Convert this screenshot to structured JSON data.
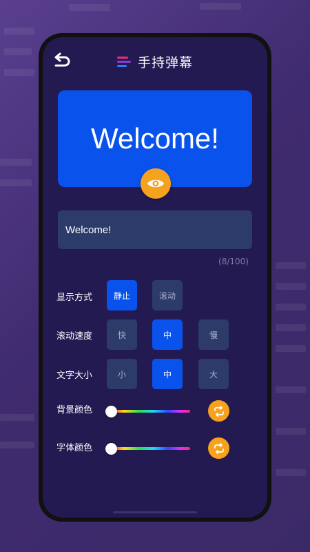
{
  "header": {
    "title": "手持弹幕",
    "back_icon": "back-arrow-icon",
    "logo_icon": "stripes-logo-icon"
  },
  "preview": {
    "text": "Welcome!",
    "preview_icon": "eye-icon",
    "background": "#0a52ec",
    "text_color": "#ffffff"
  },
  "input": {
    "value": "Welcome!",
    "counter": "(8/100)"
  },
  "display_mode": {
    "label": "显示方式",
    "options": [
      "静止",
      "滚动"
    ],
    "selected": "静止"
  },
  "scroll_speed": {
    "label": "滚动速度",
    "options": [
      "快",
      "中",
      "慢"
    ],
    "selected": "中"
  },
  "text_size": {
    "label": "文字大小",
    "options": [
      "小",
      "中",
      "大"
    ],
    "selected": "中"
  },
  "background_color": {
    "label": "背景颜色",
    "slider_value": 0,
    "refresh_icon": "refresh-icon"
  },
  "font_color": {
    "label": "字体颜色",
    "slider_value": 0,
    "refresh_icon": "refresh-icon"
  },
  "colors": {
    "accent_blue": "#0a52ec",
    "accent_orange": "#f6a21e",
    "panel": "#241a52",
    "field": "#2c3b6a"
  }
}
